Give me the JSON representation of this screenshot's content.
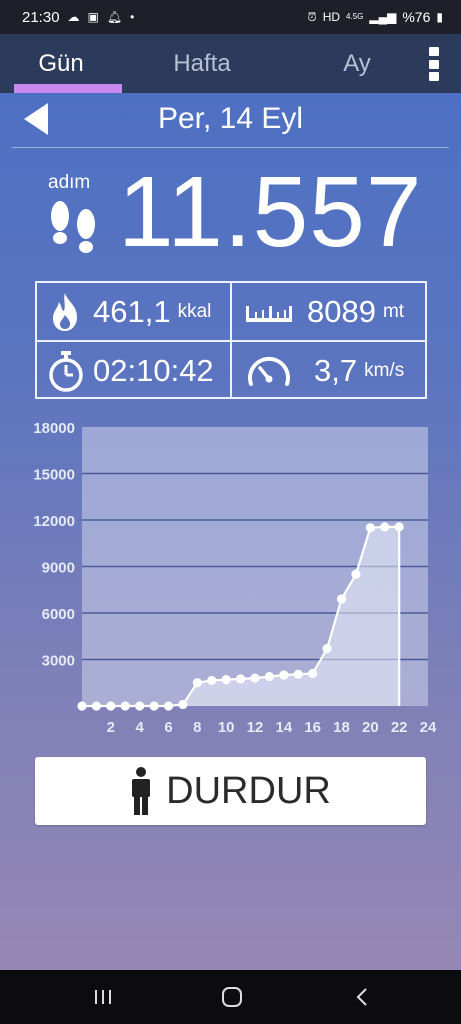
{
  "status_bar": {
    "time": "21:30",
    "battery": "%76",
    "network": "4.5G"
  },
  "tabs": [
    {
      "label": "Gün",
      "active": true
    },
    {
      "label": "Hafta",
      "active": false
    },
    {
      "label": "Ay",
      "active": false
    }
  ],
  "header": {
    "date": "Per, 14 Eyl"
  },
  "steps": {
    "label": "adım",
    "value": "11.557"
  },
  "stats": {
    "calories": {
      "value": "461,1",
      "unit": "kkal",
      "icon": "flame-icon"
    },
    "distance": {
      "value": "8089",
      "unit": "mt",
      "icon": "ruler-icon"
    },
    "duration": {
      "value": "02:10:42",
      "icon": "stopwatch-icon"
    },
    "speed": {
      "value": "3,7",
      "unit": "km/s",
      "icon": "speedometer-icon"
    }
  },
  "stop_button": {
    "label": "DURDUR",
    "icon": "person-icon"
  },
  "colors": {
    "tab_indicator": "#c98af0",
    "tab_bar": "#2c3a5c",
    "gradient_top": "#4a6fc4",
    "gradient_bottom": "#9a88b4"
  },
  "chart_data": {
    "type": "area",
    "x": [
      0,
      1,
      2,
      3,
      4,
      5,
      6,
      7,
      8,
      9,
      10,
      11,
      12,
      13,
      14,
      15,
      16,
      17,
      18,
      19,
      20,
      21,
      22
    ],
    "values": [
      0,
      0,
      0,
      0,
      0,
      0,
      0,
      100,
      1500,
      1650,
      1700,
      1750,
      1800,
      1900,
      2000,
      2050,
      2100,
      3700,
      6900,
      8500,
      11500,
      11557,
      11557
    ],
    "x_ticks": [
      2,
      4,
      6,
      8,
      10,
      12,
      14,
      16,
      18,
      20,
      22,
      24
    ],
    "y_ticks": [
      3000,
      6000,
      9000,
      12000,
      15000,
      18000
    ],
    "xlim": [
      0,
      24
    ],
    "ylim": [
      0,
      18000
    ],
    "grid": true,
    "title": "",
    "xlabel": "",
    "ylabel": ""
  }
}
